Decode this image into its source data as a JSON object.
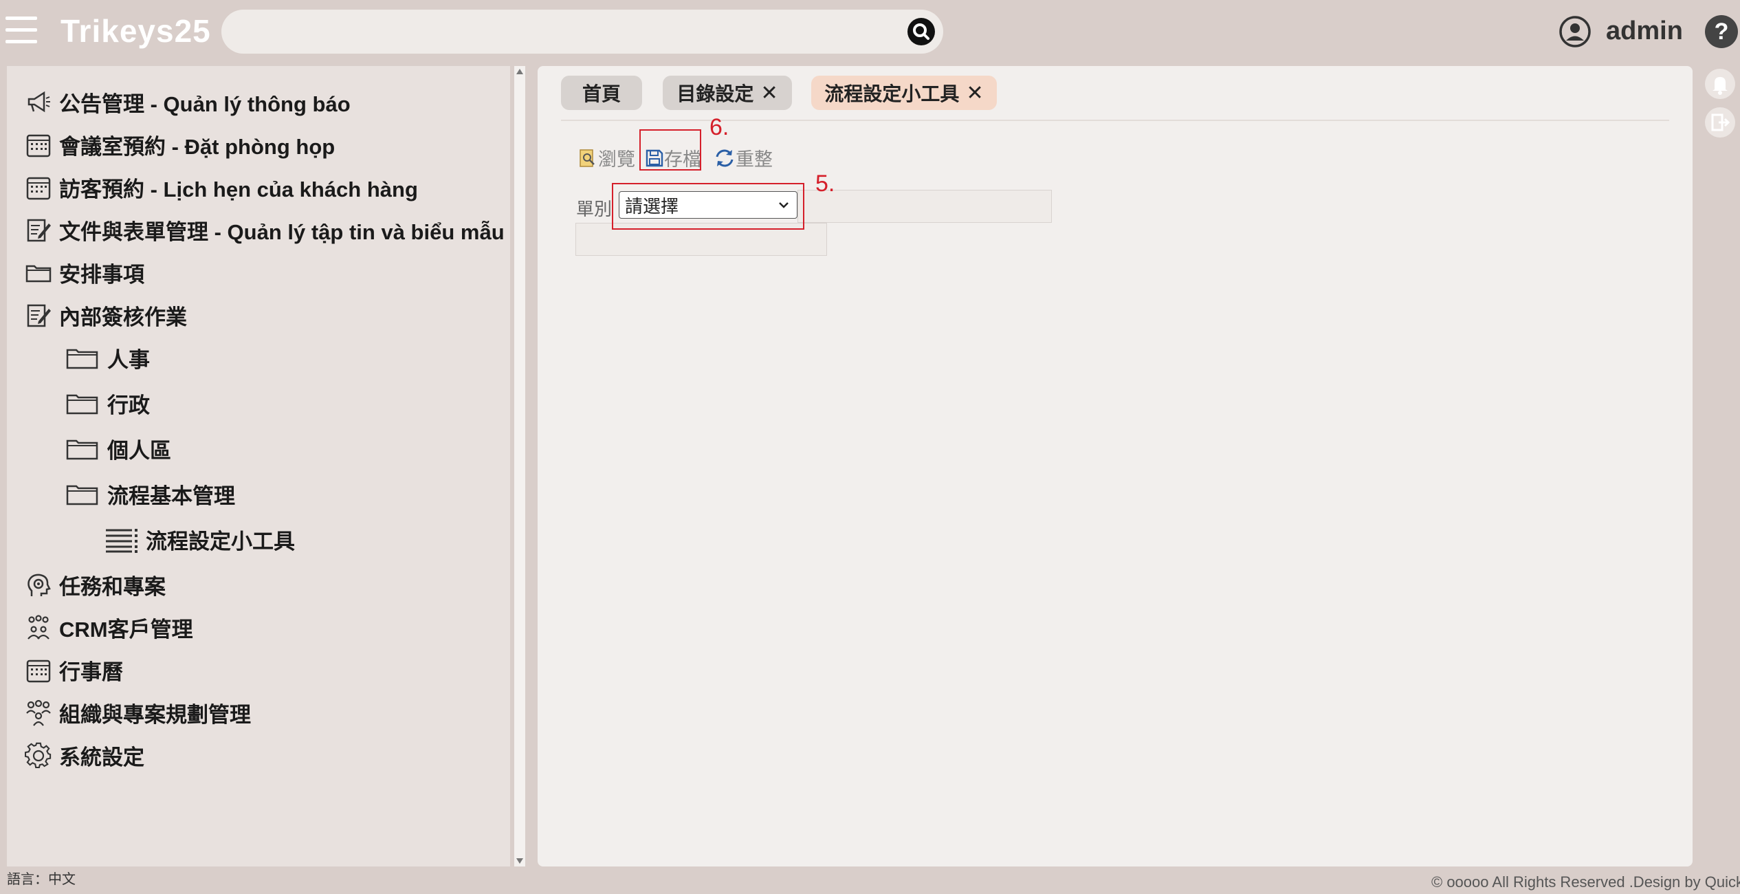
{
  "header": {
    "brand": "Trikeys25",
    "search_placeholder": "",
    "user_name": "admin",
    "help": "?"
  },
  "sidebar": {
    "items": [
      {
        "label": "公告管理 - Quản lý thông báo",
        "icon": "megaphone-icon"
      },
      {
        "label": "會議室預約 - Đặt phòng họp",
        "icon": "calendar-icon"
      },
      {
        "label": "訪客預約 - Lịch hẹn của khách hàng",
        "icon": "calendar-icon"
      },
      {
        "label": "文件與表單管理 - Quản lý tập tin và biểu mẫu",
        "icon": "edit-document-icon"
      },
      {
        "label": "安排事項",
        "icon": "folder-icon"
      },
      {
        "label": "內部簽核作業",
        "icon": "edit-document-icon"
      },
      {
        "label": "人事",
        "icon": "folder-icon"
      },
      {
        "label": "行政",
        "icon": "folder-icon"
      },
      {
        "label": "個人區",
        "icon": "folder-icon"
      },
      {
        "label": "流程基本管理",
        "icon": "folder-icon"
      },
      {
        "label": "流程設定小工具",
        "icon": "list-icon"
      },
      {
        "label": "任務和專案",
        "icon": "gear-head-icon"
      },
      {
        "label": "CRM客戶管理",
        "icon": "people-icon"
      },
      {
        "label": "行事曆",
        "icon": "calendar-icon"
      },
      {
        "label": "組織與專案規劃管理",
        "icon": "org-chart-icon"
      },
      {
        "label": "系統設定",
        "icon": "gear-icon"
      }
    ]
  },
  "tabs": [
    {
      "label": "首頁",
      "closable": false
    },
    {
      "label": "目錄設定",
      "closable": true
    },
    {
      "label": "流程設定小工具",
      "closable": true,
      "active": true
    }
  ],
  "toolbar": {
    "browse_label": "瀏覽",
    "save_label": "存檔",
    "reset_label": "重整"
  },
  "form": {
    "field_label": "單別",
    "select_value": "請選擇"
  },
  "annotations": {
    "save_step": "6.",
    "select_step": "5."
  },
  "footer": {
    "language": "語言：中文",
    "copyright": "© ooooo All Rights Reserved .Design by Quickin"
  },
  "colors": {
    "background": "#d9ceca",
    "panel": "#f2efed",
    "active_tab": "#f5d8c8",
    "inactive_tab": "#d7d2cf",
    "annotation": "#d51f2a"
  }
}
